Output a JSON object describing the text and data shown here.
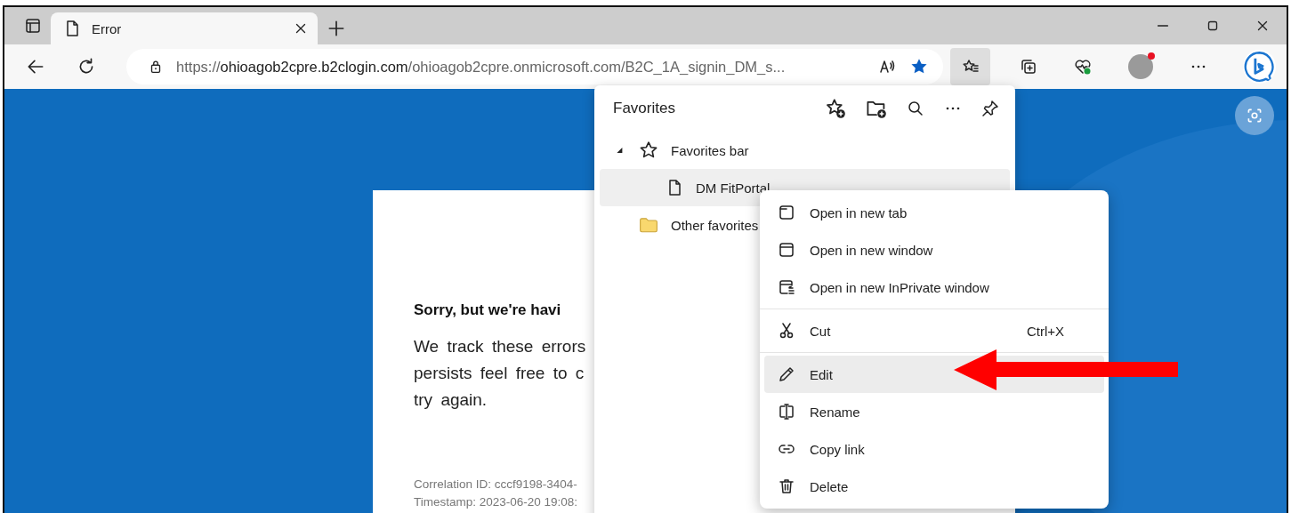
{
  "tabs": [
    {
      "title": "Error",
      "selected": true
    }
  ],
  "address_bar": {
    "scheme": "https://",
    "host": "ohioagob2cpre.b2clogin.com",
    "path": "/ohioagob2cpre.onmicrosoft.com/B2C_1A_signin_DM_s...",
    "favorited": true
  },
  "favorites_panel": {
    "title": "Favorites",
    "tree": [
      {
        "label": "Favorites bar",
        "kind": "bar",
        "expanded": true,
        "selected": false,
        "children": [
          {
            "label": "DM FitPortal",
            "kind": "page",
            "selected": true
          }
        ]
      },
      {
        "label": "Other favorites",
        "kind": "folder",
        "selected": false
      }
    ]
  },
  "context_menu": {
    "groups": [
      [
        {
          "label": "Open in new tab",
          "selected": false
        },
        {
          "label": "Open in new window",
          "selected": false
        },
        {
          "label": "Open in new InPrivate window",
          "selected": false
        }
      ],
      [
        {
          "label": "Cut",
          "shortcut": "Ctrl+X",
          "selected": false
        }
      ],
      [
        {
          "label": "Edit",
          "selected": true
        },
        {
          "label": "Rename",
          "selected": false
        },
        {
          "label": "Copy link",
          "selected": false
        },
        {
          "label": "Delete",
          "selected": false
        }
      ]
    ]
  },
  "error_card": {
    "heading": "Sorry, but we're havi",
    "body_lines": [
      "We track these errors",
      "persists feel free to c",
      "try again."
    ],
    "details": [
      "Correlation ID: cccf9198-3404-",
      "Timestamp: 2023-06-20 19:08:"
    ]
  }
}
